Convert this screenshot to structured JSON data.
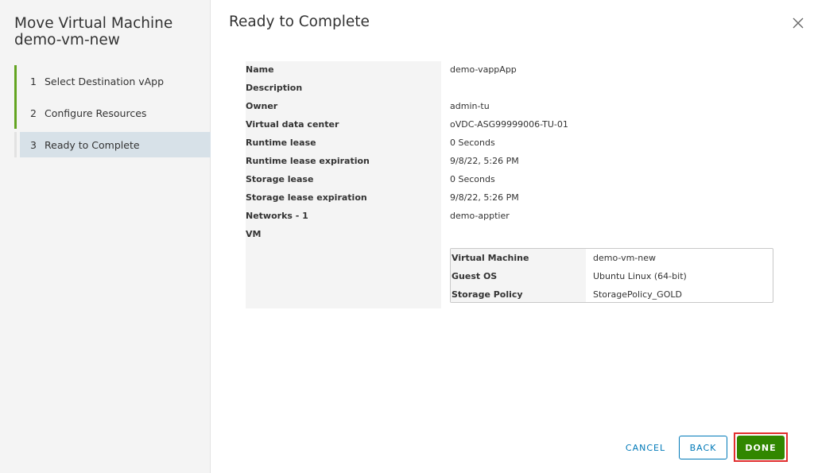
{
  "wizard": {
    "title_line1": "Move Virtual Machine",
    "title_line2": "demo-vm-new",
    "steps": [
      {
        "num": "1",
        "label": "Select Destination vApp"
      },
      {
        "num": "2",
        "label": "Configure Resources"
      },
      {
        "num": "3",
        "label": "Ready to Complete"
      }
    ]
  },
  "main": {
    "title": "Ready to Complete",
    "properties": [
      {
        "key": "Name",
        "value": "demo-vappApp"
      },
      {
        "key": "Description",
        "value": ""
      },
      {
        "key": "Owner",
        "value": "admin-tu"
      },
      {
        "key": "Virtual data center",
        "value": "oVDC-ASG99999006-TU-01"
      },
      {
        "key": "Runtime lease",
        "value": "0 Seconds"
      },
      {
        "key": "Runtime lease expiration",
        "value": "9/8/22, 5:26 PM"
      },
      {
        "key": "Storage lease",
        "value": "0 Seconds"
      },
      {
        "key": "Storage lease expiration",
        "value": "9/8/22, 5:26 PM"
      },
      {
        "key": "Networks - 1",
        "value": "demo-apptier"
      },
      {
        "key": "VM",
        "value": ""
      }
    ],
    "vm": [
      {
        "key": "Virtual Machine",
        "value": "demo-vm-new"
      },
      {
        "key": "Guest OS",
        "value": "Ubuntu Linux (64-bit)"
      },
      {
        "key": "Storage Policy",
        "value": "StoragePolicy_GOLD"
      }
    ]
  },
  "footer": {
    "cancel_label": "CANCEL",
    "back_label": "BACK",
    "done_label": "DONE"
  },
  "icons": {
    "close": "close-icon"
  },
  "colors": {
    "accent_green": "#62a420",
    "done_button": "#318700",
    "link_blue": "#0079b8",
    "highlight_red": "#e12e2e",
    "current_step_bg": "#d7e1e8"
  }
}
